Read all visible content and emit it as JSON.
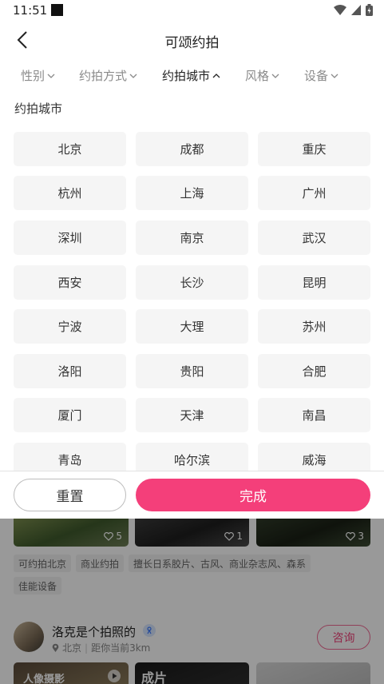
{
  "status_bar": {
    "time": "11:51"
  },
  "nav": {
    "title": "可颂约拍"
  },
  "filters": [
    {
      "label": "性别",
      "active": false
    },
    {
      "label": "约拍方式",
      "active": false
    },
    {
      "label": "约拍城市",
      "active": true
    },
    {
      "label": "风格",
      "active": false
    },
    {
      "label": "设备",
      "active": false
    }
  ],
  "panel": {
    "section_title": "约拍城市",
    "cities": [
      "北京",
      "成都",
      "重庆",
      "杭州",
      "上海",
      "广州",
      "深圳",
      "南京",
      "武汉",
      "西安",
      "长沙",
      "昆明",
      "宁波",
      "大理",
      "苏州",
      "洛阳",
      "贵阳",
      "合肥",
      "厦门",
      "天津",
      "南昌",
      "青岛",
      "哈尔滨",
      "威海"
    ],
    "reset_label": "重置",
    "done_label": "完成"
  },
  "background": {
    "thumb_likes": [
      "5",
      "1",
      "3"
    ],
    "tags": [
      "可约拍北京",
      "商业约拍",
      "擅长日系胶片、古风、商业杂志风、森系",
      "佳能设备"
    ],
    "photographer": {
      "name": "洛克是个拍照的",
      "city": "北京",
      "distance": "距你当前3km",
      "consult_label": "咨询"
    },
    "bottom_thumb_texts": [
      "人像摄影",
      "成片"
    ]
  },
  "colors": {
    "accent": "#f43f7a",
    "chip_bg": "#f5f5f5",
    "overlay": "rgba(0,0,0,0.40)"
  }
}
